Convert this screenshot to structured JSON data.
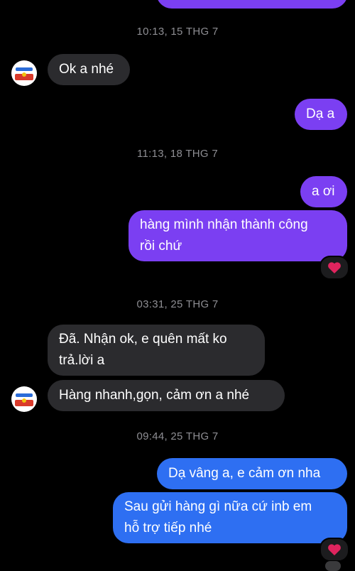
{
  "timestamps": [
    "10:13, 15 THG 7",
    "11:13, 18 THG 7",
    "03:31, 25 THG 7",
    "09:44, 25 THG 7"
  ],
  "messages": {
    "m1": "Ok a nhé",
    "m2": "Dạ a",
    "m3": "a ơi",
    "m4_line1": "hàng mình nhận thành công",
    "m4_line2": "rồi chứ",
    "m5_line1": "Đã. Nhận ok, e quên mất ko",
    "m5_line2": "trả.lời a",
    "m6": "Hàng nhanh,gọn, cảm ơn a nhé",
    "m7": "Dạ vâng a, e cảm ơn nha",
    "m8_line1": "Sau gửi hàng gì nữa cứ inb em",
    "m8_line2": "hỗ trợ tiếp nhé"
  },
  "reactions": {
    "r1": "heart-icon",
    "r2": "heart-icon"
  },
  "colors": {
    "background": "#000000",
    "incoming_bubble": "#2b2b2e",
    "outgoing_purple": "#7b3ff2",
    "outgoing_blue": "#2e6ff2",
    "timestamp": "#8e8e93",
    "heart": "#e0245e"
  }
}
